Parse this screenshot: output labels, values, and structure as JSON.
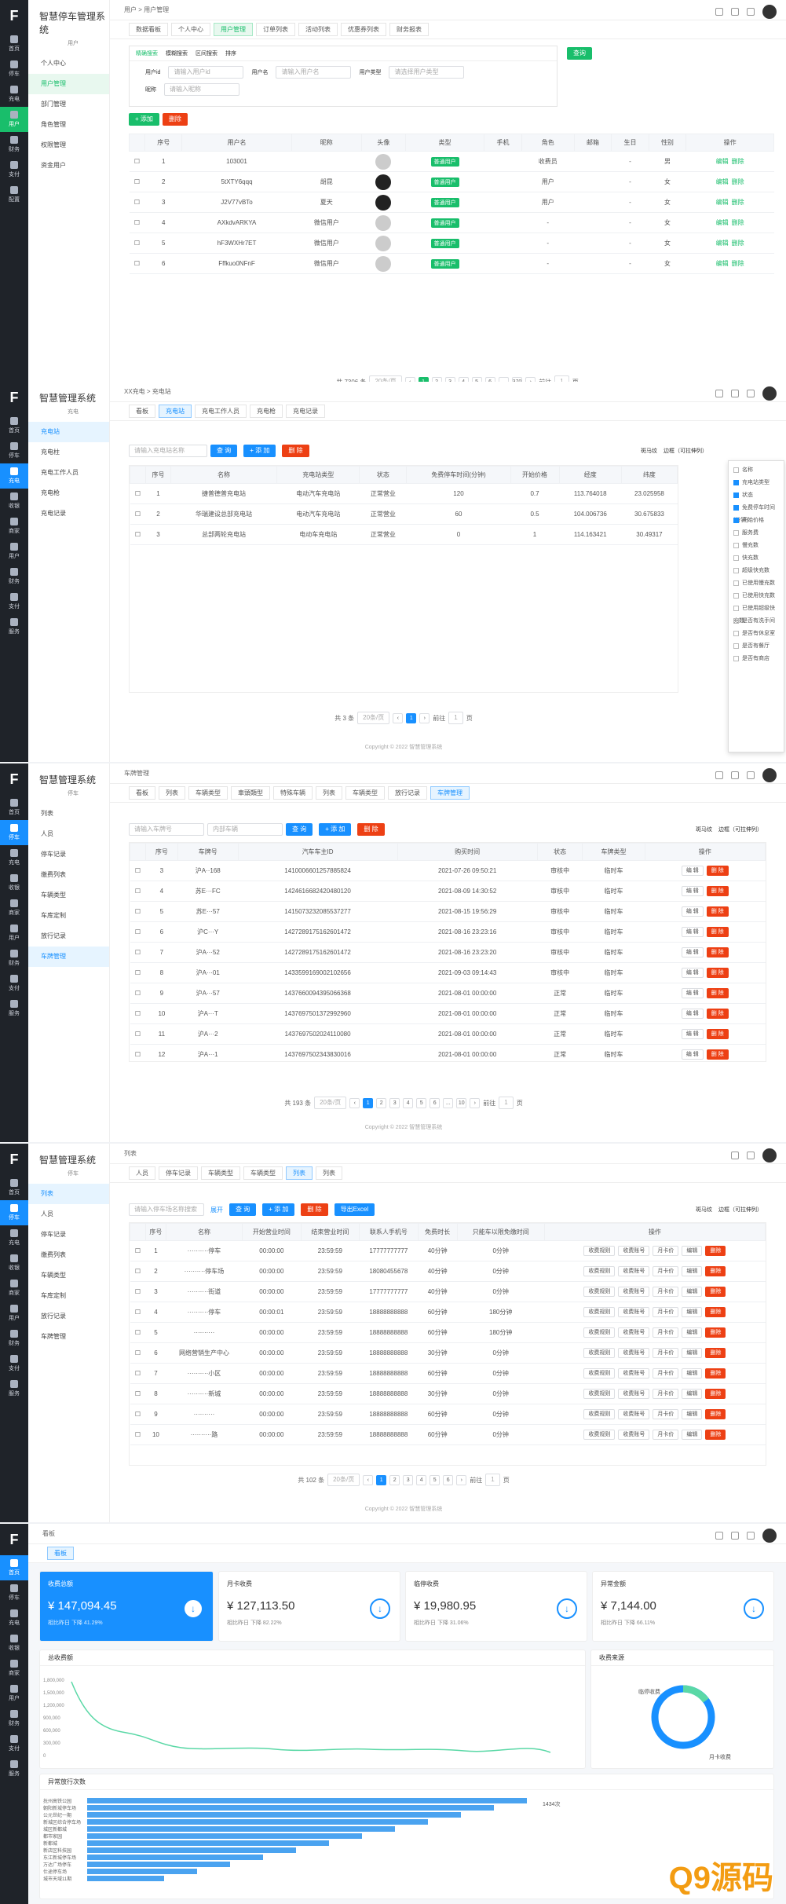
{
  "s1": {
    "sys": "智慧停车管理系统",
    "sub": "用户",
    "rail": [
      "首页",
      "停车",
      "充电",
      "用户",
      "财务",
      "支付",
      "配置"
    ],
    "menu": [
      "个人中心",
      "用户管理",
      "部门管理",
      "角色管理",
      "权限管理",
      "资金用户"
    ],
    "crumb": "用户  >  用户管理",
    "tabs": [
      "数据看板",
      "个人中心",
      "用户管理",
      "订单列表",
      "活动列表",
      "优惠券列表",
      "财务报表"
    ],
    "search_tabs": [
      "精确搜索",
      "模糊搜索",
      "区间搜索",
      "排序"
    ],
    "f_uid": "用户id",
    "f_uid_ph": "请输入用户id",
    "f_name": "用户名",
    "f_name_ph": "请输入用户名",
    "f_type": "用户类型",
    "f_type_ph": "请选择用户类型",
    "f_nick": "昵称",
    "f_nick_ph": "请输入昵称",
    "btn_search": "查询",
    "btn_add": "+ 添加",
    "btn_del": "删除",
    "headers": [
      "序号",
      "用户名",
      "昵称",
      "头像",
      "类型",
      "手机",
      "角色",
      "邮箱",
      "生日",
      "性别",
      "操作"
    ],
    "rows": [
      {
        "no": "1",
        "user": "103001",
        "nick": "",
        "type": "普通用户",
        "phone": "",
        "role": "收费员",
        "mail": "",
        "bday": "-",
        "sex": "男"
      },
      {
        "no": "2",
        "user": "5tXTY6qqq",
        "nick": "胡昆",
        "type": "普通用户",
        "phone": "",
        "role": "用户",
        "mail": "",
        "bday": "-",
        "sex": "女"
      },
      {
        "no": "3",
        "user": "J2V77vBTo",
        "nick": "夏天",
        "type": "普通用户",
        "phone": "",
        "role": "用户",
        "mail": "",
        "bday": "-",
        "sex": "女"
      },
      {
        "no": "4",
        "user": "AXkdvARKYA",
        "nick": "微信用户",
        "type": "普通用户",
        "phone": "",
        "role": "-",
        "mail": "",
        "bday": "-",
        "sex": "女"
      },
      {
        "no": "5",
        "user": "hF3WXHr7ET",
        "nick": "微信用户",
        "type": "普通用户",
        "phone": "",
        "role": "-",
        "mail": "",
        "bday": "-",
        "sex": "女"
      },
      {
        "no": "6",
        "user": "Fffkuo0NFnF",
        "nick": "微信用户",
        "type": "普通用户",
        "phone": "",
        "role": "-",
        "mail": "",
        "bday": "-",
        "sex": "女"
      }
    ],
    "op_edit": "编辑",
    "op_del": "删除",
    "total": "共 7306 条",
    "size": "20条/页",
    "pages": [
      "1",
      "2",
      "3",
      "4",
      "5",
      "6",
      "...",
      "370"
    ],
    "goto": "前往",
    "gotoval": "1",
    "pageword": "页"
  },
  "s2": {
    "sys": "智慧管理系统",
    "sub": "充电",
    "rail": [
      "首页",
      "停车",
      "充电",
      "收银",
      "商家",
      "用户",
      "财务",
      "支付",
      "服务"
    ],
    "menu": [
      "充电站",
      "充电柱",
      "充电工作人员",
      "充电枪",
      "充电记录"
    ],
    "crumb": "XX充电  >  充电站",
    "tabs": [
      "看板",
      "充电站",
      "充电工作人员",
      "充电枪",
      "充电记录"
    ],
    "search_ph": "请输入充电站名称",
    "btn_search": "查 询",
    "btn_add": "+ 添 加",
    "btn_del": "删 除",
    "opt1": "斑马纹",
    "opt2": "边框（可拉伸列）",
    "headers": [
      "序号",
      "名称",
      "充电站类型",
      "状态",
      "免费停车时间(分钟)",
      "开始价格",
      "经度",
      "纬度"
    ],
    "rows": [
      {
        "no": "1",
        "name": "捷普德普充电站",
        "type": "电动汽车充电站",
        "state": "正常营业",
        "free": "120",
        "price": "0.7",
        "lng": "113.764018",
        "lat": "23.025958"
      },
      {
        "no": "2",
        "name": "华瑞建设总部充电站",
        "type": "电动汽车充电站",
        "state": "正常营业",
        "free": "60",
        "price": "0.5",
        "lng": "104.006736",
        "lat": "30.675833"
      },
      {
        "no": "3",
        "name": "总部两轮充电站",
        "type": "电动车充电站",
        "state": "正常营业",
        "free": "0",
        "price": "1",
        "lng": "114.163421",
        "lat": "30.49317"
      }
    ],
    "cols": [
      "名称",
      "充电站类型",
      "状态",
      "免费停车时间(分钟)",
      "开始价格",
      "服务费",
      "慢充数",
      "快充数",
      "超级快充数",
      "已使用慢充数",
      "已使用快充数",
      "已使用超级快充数",
      "是否有洗手间",
      "是否有休息室",
      "是否有餐厅",
      "是否有商店"
    ],
    "total": "共 3 条",
    "size": "20条/页",
    "page": "1",
    "goto": "前往",
    "gotoval": "1",
    "pageword": "页",
    "copy": "Copyright © 2022 智慧管理系统"
  },
  "s3": {
    "sys": "智慧管理系统",
    "sub": "停车",
    "rail": [
      "首页",
      "停车",
      "充电",
      "收银",
      "商家",
      "用户",
      "财务",
      "支付",
      "服务"
    ],
    "menu": [
      "列表",
      "人员",
      "停车记录",
      "缴费列表",
      "车辆类型",
      "车库定制",
      "放行记录",
      "车牌管理"
    ],
    "crumb": "车牌管理",
    "tabs": [
      "看板",
      "列表",
      "车辆类型",
      "車頭類型",
      "特殊车辆",
      "列表",
      "车辆类型",
      "放行记录",
      "车牌管理"
    ],
    "search_ph": "请输入车牌号",
    "search_ph2": "内部车辆",
    "btn_search": "查 询",
    "btn_add": "+ 添 加",
    "btn_del": "删 除",
    "opt1": "斑马纹",
    "opt2": "边框（可拉伸列）",
    "headers": [
      "序号",
      "车牌号",
      "汽车车主ID",
      "购买时间",
      "状态",
      "车牌类型",
      "操作"
    ],
    "rows": [
      {
        "no": "3",
        "plate": "沪A··168",
        "oid": "1410006601257885824",
        "time": "2021-07-26 09:50:21",
        "state": "审核中",
        "type": "临时车"
      },
      {
        "no": "4",
        "plate": "苏E···FC",
        "oid": "1424616682420480120",
        "time": "2021-08-09 14:30:52",
        "state": "审核中",
        "type": "临时车"
      },
      {
        "no": "5",
        "plate": "苏E···57",
        "oid": "1415073232085537277",
        "time": "2021-08-15 19:56:29",
        "state": "审核中",
        "type": "临时车"
      },
      {
        "no": "6",
        "plate": "沪C···Y",
        "oid": "1427289175162601472",
        "time": "2021-08-16 23:23:16",
        "state": "审核中",
        "type": "临时车"
      },
      {
        "no": "7",
        "plate": "沪A···52",
        "oid": "1427289175162601472",
        "time": "2021-08-16 23:23:20",
        "state": "审核中",
        "type": "临时车"
      },
      {
        "no": "8",
        "plate": "沪A···01",
        "oid": "1433599169002102656",
        "time": "2021-09-03 09:14:43",
        "state": "审核中",
        "type": "临时车"
      },
      {
        "no": "9",
        "plate": "沪A···57",
        "oid": "1437660094395066368",
        "time": "2021-08-01 00:00:00",
        "state": "正常",
        "type": "临时车"
      },
      {
        "no": "10",
        "plate": "沪A···T",
        "oid": "1437697501372992960",
        "time": "2021-08-01 00:00:00",
        "state": "正常",
        "type": "临时车"
      },
      {
        "no": "11",
        "plate": "沪A···2",
        "oid": "1437697502024110080",
        "time": "2021-08-01 00:00:00",
        "state": "正常",
        "type": "临时车"
      },
      {
        "no": "12",
        "plate": "沪A···1",
        "oid": "1437697502343830016",
        "time": "2021-08-01 00:00:00",
        "state": "正常",
        "type": "临时车"
      }
    ],
    "op_edit": "编 辑",
    "op_del": "删 除",
    "total": "共 193 条",
    "size": "20条/页",
    "pages": [
      "1",
      "2",
      "3",
      "4",
      "5",
      "6",
      "...",
      "10"
    ],
    "goto": "前往",
    "gotoval": "1",
    "pageword": "页",
    "copy": "Copyright © 2022 智慧管理系统"
  },
  "s4": {
    "sys": "智慧管理系统",
    "sub": "停车",
    "rail": [
      "首页",
      "停车",
      "充电",
      "收银",
      "商家",
      "用户",
      "财务",
      "支付",
      "服务"
    ],
    "menu": [
      "列表",
      "人员",
      "停车记录",
      "缴费列表",
      "车辆类型",
      "车库定制",
      "放行记录",
      "车牌管理"
    ],
    "crumb": "列表",
    "tabs": [
      "人员",
      "停车记录",
      "车辆类型",
      "车辆类型",
      "列表",
      "列表"
    ],
    "search_ph": "请输入停车场名称搜索",
    "expand": "展开",
    "btn_search": "查 询",
    "btn_add": "+ 添 加",
    "btn_del": "删 除",
    "btn_export": "导出Excel",
    "opt1": "斑马纹",
    "opt2": "边框（可拉伸列）",
    "headers": [
      "序号",
      "名称",
      "开始营业时间",
      "结束营业时间",
      "联系人手机号",
      "免费时长",
      "只能车以限免缴时间",
      "操作"
    ],
    "rows": [
      {
        "no": "1",
        "name": "··········停车",
        "open": "00:00:00",
        "close": "23:59:59",
        "phone": "17777777777",
        "free": "40分钟",
        "lim": "0分钟"
      },
      {
        "no": "2",
        "name": "··········停车场",
        "open": "00:00:00",
        "close": "23:59:59",
        "phone": "18080455678",
        "free": "40分钟",
        "lim": "0分钟"
      },
      {
        "no": "3",
        "name": "··········街道",
        "open": "00:00:00",
        "close": "23:59:59",
        "phone": "17777777777",
        "free": "40分钟",
        "lim": "0分钟"
      },
      {
        "no": "4",
        "name": "··········停车",
        "open": "00:00:01",
        "close": "23:59:59",
        "phone": "18888888888",
        "free": "60分钟",
        "lim": "180分钟"
      },
      {
        "no": "5",
        "name": "··········",
        "open": "00:00:00",
        "close": "23:59:59",
        "phone": "18888888888",
        "free": "60分钟",
        "lim": "180分钟"
      },
      {
        "no": "6",
        "name": "网络营销生产中心",
        "open": "00:00:00",
        "close": "23:59:59",
        "phone": "18888888888",
        "free": "30分钟",
        "lim": "0分钟"
      },
      {
        "no": "7",
        "name": "··········小区",
        "open": "00:00:00",
        "close": "23:59:59",
        "phone": "18888888888",
        "free": "60分钟",
        "lim": "0分钟"
      },
      {
        "no": "8",
        "name": "··········新城",
        "open": "00:00:00",
        "close": "23:59:59",
        "phone": "18888888888",
        "free": "30分钟",
        "lim": "0分钟"
      },
      {
        "no": "9",
        "name": "··········",
        "open": "00:00:00",
        "close": "23:59:59",
        "phone": "18888888888",
        "free": "60分钟",
        "lim": "0分钟"
      },
      {
        "no": "10",
        "name": "··········路",
        "open": "00:00:00",
        "close": "23:59:59",
        "phone": "18888888888",
        "free": "60分钟",
        "lim": "0分钟"
      }
    ],
    "ops": [
      "收费规则",
      "收费账号",
      "月卡价",
      "编辑",
      "删除"
    ],
    "total": "共 102 条",
    "size": "20条/页",
    "pages": [
      "1",
      "2",
      "3",
      "4",
      "5",
      "6"
    ],
    "goto": "前往",
    "gotoval": "1",
    "pageword": "页",
    "copy": "Copyright © 2022 智慧管理系统"
  },
  "s5": {
    "rail": [
      "首页",
      "停车",
      "充电",
      "收银",
      "商家",
      "用户",
      "财务",
      "支付",
      "服务"
    ],
    "crumb": "看板",
    "tab": "看板",
    "cards": [
      {
        "t": "收费总额",
        "v": "¥ 147,094.45",
        "s": "相比昨日 下降 41.29%"
      },
      {
        "t": "月卡收费",
        "v": "¥ 127,113.50",
        "s": "相比昨日 下降 82.22%"
      },
      {
        "t": "临停收费",
        "v": "¥ 19,980.95",
        "s": "相比昨日 下降 31.06%"
      },
      {
        "t": "异常金额",
        "v": "¥ 7,144.00",
        "s": "相比昨日 下降 66.11%"
      }
    ],
    "trend_title": "总收费额",
    "pie_title": "收费来源",
    "pie_legend": [
      "临停收费",
      "月卡收费"
    ],
    "bar_title": "异常放行次数",
    "bar_max_label": "1434次",
    "trend_y": [
      "1,800,000",
      "1,500,000",
      "1,200,000",
      "900,000",
      "600,000",
      "300,000",
      "0"
    ],
    "bar_cats": [
      "抚州高铁公园",
      "朝阳新城停车场",
      "公元世纪一期",
      "新城区综合停车场",
      "城区新都城",
      "都市家园",
      "新都城",
      "新店区科技园",
      "东江新城停车场",
      "万达广场停车",
      "仕途停车场",
      "城市天域11期"
    ],
    "watermark": "Q9源码",
    "icons": {
      "down": "arrow-down-icon"
    }
  }
}
